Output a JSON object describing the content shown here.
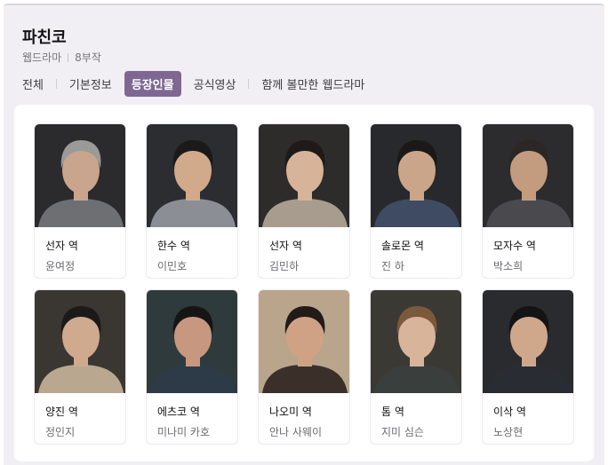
{
  "show": {
    "title": "파친코",
    "genre": "웹드라마",
    "episodes": "8부작"
  },
  "tabs": [
    {
      "label": "전체",
      "active": false
    },
    {
      "label": "기본정보",
      "active": false
    },
    {
      "label": "등장인물",
      "active": true
    },
    {
      "label": "공식영상",
      "active": false
    },
    {
      "label": "함께 볼만한 웹드라마",
      "active": false
    }
  ],
  "cast": [
    {
      "role": "선자 역",
      "actor": "윤여정",
      "bg": "#2b2a2c",
      "hair": "#9a9a98",
      "skin": "#c9a58e",
      "cloth": "#6e6f73"
    },
    {
      "role": "한수 역",
      "actor": "이민호",
      "bg": "#2c2d31",
      "hair": "#1b1a1a",
      "skin": "#d1aa8b",
      "cloth": "#8b8f95"
    },
    {
      "role": "선자 역",
      "actor": "김민하",
      "bg": "#2e2c2b",
      "hair": "#1d1a18",
      "skin": "#d7b39a",
      "cloth": "#a89c8e"
    },
    {
      "role": "솔로몬 역",
      "actor": "진 하",
      "bg": "#28292c",
      "hair": "#1a1918",
      "skin": "#caa58a",
      "cloth": "#3f4b63"
    },
    {
      "role": "모자수 역",
      "actor": "박소희",
      "bg": "#2c2c2e",
      "hair": "#2a2725",
      "skin": "#c39c80",
      "cloth": "#4a4a4e"
    },
    {
      "role": "양진 역",
      "actor": "정인지",
      "bg": "#3a3733",
      "hair": "#1c1a19",
      "skin": "#cfaa8f",
      "cloth": "#b9a88f"
    },
    {
      "role": "에츠코 역",
      "actor": "미나미 카호",
      "bg": "#2f3a3c",
      "hair": "#161515",
      "skin": "#c7977f",
      "cloth": "#2d3a48"
    },
    {
      "role": "나오미 역",
      "actor": "안나 사웨이",
      "bg": "#b9a58c",
      "hair": "#221b18",
      "skin": "#cfa286",
      "cloth": "#3b2f2a"
    },
    {
      "role": "톰 역",
      "actor": "지미 심슨",
      "bg": "#3a3934",
      "hair": "#7a5a3a",
      "skin": "#d8b49a",
      "cloth": "#3a3f3e"
    },
    {
      "role": "이삭 역",
      "actor": "노상현",
      "bg": "#2a2b2e",
      "hair": "#151414",
      "skin": "#cfa88c",
      "cloth": "#2a2c33"
    }
  ]
}
